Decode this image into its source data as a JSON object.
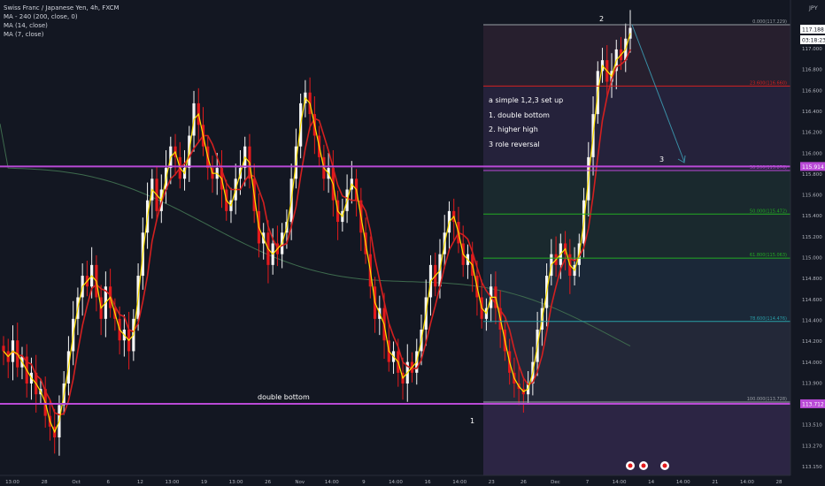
{
  "legend": {
    "symbol_title": "Swiss Franc / Japanese Yen, 4h, FXCM",
    "indicators": [
      "MA - 240 (200, close, 0)",
      "MA (14, close)",
      "MA (7, close)"
    ]
  },
  "currency_label": "JPY",
  "colors": {
    "background": "#131722",
    "up": "#f5f5f5",
    "down": "#e31a1c",
    "ma7": "#ffe100",
    "ma14": "#d32020",
    "ma200": "#3e6b4e",
    "resistance": "#b94ad6",
    "projection": "#3a8fa6"
  },
  "annotations": {
    "notes_title": "a simple 1,2,3 set up",
    "note_1": "1. double bottom",
    "note_2": "2. higher high",
    "note_3": "3 role reversal",
    "double_bottom_label": "double bottom",
    "point_1": "1",
    "point_2": "2",
    "point_3": "3"
  },
  "chart_data": {
    "type": "candlestick",
    "instrument": "Swiss Franc / Japanese Yen",
    "timeframe": "4h",
    "ylim": [
      113.0,
      117.35
    ],
    "y_ticks": [
      "117.000",
      "116.800",
      "116.600",
      "116.400",
      "116.200",
      "116.000",
      "115.800",
      "115.600",
      "115.400",
      "115.200",
      "115.000",
      "114.800",
      "114.600",
      "114.400",
      "114.200",
      "114.000",
      "113.900",
      "113.750",
      "113.510",
      "113.270",
      "113.150"
    ],
    "x_ticks": [
      "13:00",
      "28",
      "Oct",
      "6",
      "12",
      "13:00",
      "19",
      "13:00",
      "26",
      "Nov",
      "14:00",
      "9",
      "14:00",
      "16",
      "14:00",
      "23",
      "26",
      "Dec",
      "7",
      "14:00",
      "14",
      "14:00",
      "21",
      "14:00",
      "28"
    ],
    "price_badges": [
      {
        "label": "117.188",
        "value": 117.188,
        "color": "#ffffff",
        "text_color": "#131722"
      },
      {
        "label": "03:18:23",
        "value": 117.09,
        "color": "#ffffff",
        "text_color": "#131722"
      },
      {
        "label": "115.914",
        "value": 115.914,
        "color": "#b94ad6",
        "text_color": "#ffffff"
      },
      {
        "label": "113.712",
        "value": 113.712,
        "color": "#b94ad6",
        "text_color": "#ffffff"
      }
    ],
    "horizontal_levels": [
      {
        "name": "resistance",
        "price": 115.914
      },
      {
        "name": "double bottom",
        "price": 113.712
      }
    ],
    "fibonacci": {
      "levels": [
        {
          "label": "0.000(117.229)",
          "price": 117.229,
          "color": "#9aa0a6"
        },
        {
          "label": "23.600(116.660)",
          "price": 116.66,
          "color": "#d32020"
        },
        {
          "label": "38.200(115.876)",
          "price": 115.876,
          "color": "#b94ad6"
        },
        {
          "label": "50.000(115.472)",
          "price": 115.472,
          "color": "#22ab22"
        },
        {
          "label": "61.800(115.063)",
          "price": 115.063,
          "color": "#22ab22"
        },
        {
          "label": "78.600(114.476)",
          "price": 114.476,
          "color": "#2a9fa8"
        },
        {
          "label": "100.000(113.728)",
          "price": 113.728,
          "color": "#9aa0a6"
        }
      ]
    },
    "series": [
      {
        "name": "MA (7, close)",
        "color": "#ffe100"
      },
      {
        "name": "MA (14, close)",
        "color": "#d32020"
      },
      {
        "name": "MA - 240 (200, close, 0)",
        "color": "#3e6b4e"
      }
    ],
    "closes": [
      114.2,
      114.1,
      114.3,
      114.05,
      114.15,
      113.9,
      114.0,
      113.8,
      113.85,
      113.6,
      113.5,
      113.4,
      113.7,
      113.9,
      114.2,
      114.5,
      114.7,
      114.9,
      114.8,
      115.0,
      114.7,
      114.5,
      114.8,
      114.6,
      114.5,
      114.3,
      114.4,
      114.2,
      114.5,
      114.9,
      115.3,
      115.6,
      115.8,
      115.5,
      115.7,
      115.9,
      116.1,
      116.0,
      115.8,
      115.9,
      116.2,
      116.5,
      116.3,
      116.1,
      115.9,
      115.8,
      115.9,
      115.7,
      115.5,
      115.6,
      115.8,
      115.9,
      116.1,
      115.8,
      115.5,
      115.2,
      115.3,
      115.0,
      115.2,
      115.1,
      115.3,
      115.4,
      115.8,
      116.1,
      116.5,
      116.6,
      116.4,
      116.2,
      116.0,
      115.8,
      115.9,
      115.6,
      115.4,
      115.5,
      115.7,
      115.8,
      115.6,
      115.3,
      115.1,
      114.8,
      114.5,
      114.6,
      114.3,
      114.1,
      114.2,
      114.0,
      113.9,
      114.1,
      114.0,
      114.2,
      114.4,
      114.7,
      115.0,
      114.8,
      115.1,
      115.3,
      115.5,
      115.4,
      115.2,
      115.0,
      115.1,
      114.9,
      114.7,
      114.5,
      114.6,
      114.8,
      114.6,
      114.4,
      114.2,
      114.0,
      113.9,
      113.85,
      113.8,
      113.9,
      114.1,
      114.4,
      114.6,
      114.9,
      115.1,
      115.0,
      115.2,
      115.1,
      114.9,
      115.0,
      115.2,
      115.6,
      116.0,
      116.4,
      116.8,
      116.9,
      116.7,
      116.8,
      117.0,
      116.9,
      117.1,
      117.2
    ]
  }
}
